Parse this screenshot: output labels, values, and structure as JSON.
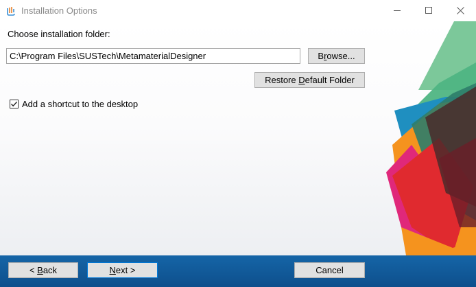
{
  "window": {
    "title": "Installation Options",
    "controls": {
      "minimize": "minimize-icon",
      "maximize": "maximize-icon",
      "close": "close-icon"
    }
  },
  "folder": {
    "label": "Choose installation folder:",
    "path": "C:\\Program Files\\SUSTech\\MetamaterialDesigner",
    "browse_prefix": "B",
    "browse_accel": "r",
    "browse_suffix": "owse...",
    "restore_prefix": "Restore ",
    "restore_accel": "D",
    "restore_suffix": "efault Folder"
  },
  "shortcut": {
    "label": "Add a shortcut to the desktop",
    "checked": true
  },
  "footer": {
    "back_prefix": "< ",
    "back_accel": "B",
    "back_suffix": "ack",
    "next_accel": "N",
    "next_suffix": "ext >",
    "cancel_label": "Cancel"
  },
  "colors": {
    "footer_blue": "#1565a7",
    "green": "#6cc08e",
    "teal": "#1f8c8c",
    "orange": "#f39a1e",
    "red": "#e12a2f",
    "magenta": "#e0287a",
    "dark": "#3a2a2a"
  }
}
